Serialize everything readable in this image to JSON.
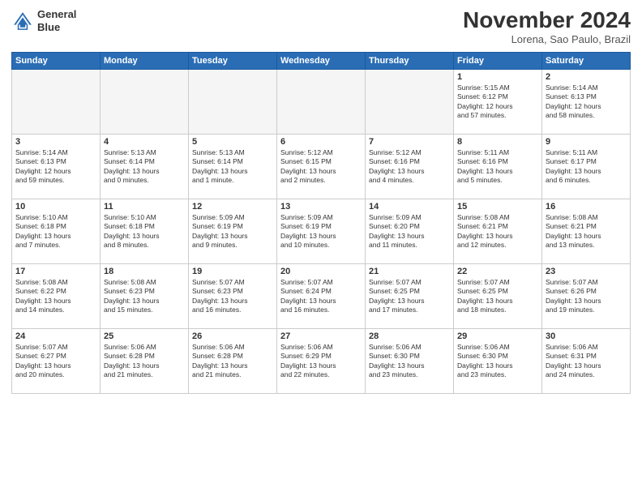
{
  "logo": {
    "line1": "General",
    "line2": "Blue"
  },
  "header": {
    "month": "November 2024",
    "location": "Lorena, Sao Paulo, Brazil"
  },
  "weekdays": [
    "Sunday",
    "Monday",
    "Tuesday",
    "Wednesday",
    "Thursday",
    "Friday",
    "Saturday"
  ],
  "weeks": [
    [
      {
        "day": "",
        "info": ""
      },
      {
        "day": "",
        "info": ""
      },
      {
        "day": "",
        "info": ""
      },
      {
        "day": "",
        "info": ""
      },
      {
        "day": "",
        "info": ""
      },
      {
        "day": "1",
        "info": "Sunrise: 5:15 AM\nSunset: 6:12 PM\nDaylight: 12 hours\nand 57 minutes."
      },
      {
        "day": "2",
        "info": "Sunrise: 5:14 AM\nSunset: 6:13 PM\nDaylight: 12 hours\nand 58 minutes."
      }
    ],
    [
      {
        "day": "3",
        "info": "Sunrise: 5:14 AM\nSunset: 6:13 PM\nDaylight: 12 hours\nand 59 minutes."
      },
      {
        "day": "4",
        "info": "Sunrise: 5:13 AM\nSunset: 6:14 PM\nDaylight: 13 hours\nand 0 minutes."
      },
      {
        "day": "5",
        "info": "Sunrise: 5:13 AM\nSunset: 6:14 PM\nDaylight: 13 hours\nand 1 minute."
      },
      {
        "day": "6",
        "info": "Sunrise: 5:12 AM\nSunset: 6:15 PM\nDaylight: 13 hours\nand 2 minutes."
      },
      {
        "day": "7",
        "info": "Sunrise: 5:12 AM\nSunset: 6:16 PM\nDaylight: 13 hours\nand 4 minutes."
      },
      {
        "day": "8",
        "info": "Sunrise: 5:11 AM\nSunset: 6:16 PM\nDaylight: 13 hours\nand 5 minutes."
      },
      {
        "day": "9",
        "info": "Sunrise: 5:11 AM\nSunset: 6:17 PM\nDaylight: 13 hours\nand 6 minutes."
      }
    ],
    [
      {
        "day": "10",
        "info": "Sunrise: 5:10 AM\nSunset: 6:18 PM\nDaylight: 13 hours\nand 7 minutes."
      },
      {
        "day": "11",
        "info": "Sunrise: 5:10 AM\nSunset: 6:18 PM\nDaylight: 13 hours\nand 8 minutes."
      },
      {
        "day": "12",
        "info": "Sunrise: 5:09 AM\nSunset: 6:19 PM\nDaylight: 13 hours\nand 9 minutes."
      },
      {
        "day": "13",
        "info": "Sunrise: 5:09 AM\nSunset: 6:19 PM\nDaylight: 13 hours\nand 10 minutes."
      },
      {
        "day": "14",
        "info": "Sunrise: 5:09 AM\nSunset: 6:20 PM\nDaylight: 13 hours\nand 11 minutes."
      },
      {
        "day": "15",
        "info": "Sunrise: 5:08 AM\nSunset: 6:21 PM\nDaylight: 13 hours\nand 12 minutes."
      },
      {
        "day": "16",
        "info": "Sunrise: 5:08 AM\nSunset: 6:21 PM\nDaylight: 13 hours\nand 13 minutes."
      }
    ],
    [
      {
        "day": "17",
        "info": "Sunrise: 5:08 AM\nSunset: 6:22 PM\nDaylight: 13 hours\nand 14 minutes."
      },
      {
        "day": "18",
        "info": "Sunrise: 5:08 AM\nSunset: 6:23 PM\nDaylight: 13 hours\nand 15 minutes."
      },
      {
        "day": "19",
        "info": "Sunrise: 5:07 AM\nSunset: 6:23 PM\nDaylight: 13 hours\nand 16 minutes."
      },
      {
        "day": "20",
        "info": "Sunrise: 5:07 AM\nSunset: 6:24 PM\nDaylight: 13 hours\nand 16 minutes."
      },
      {
        "day": "21",
        "info": "Sunrise: 5:07 AM\nSunset: 6:25 PM\nDaylight: 13 hours\nand 17 minutes."
      },
      {
        "day": "22",
        "info": "Sunrise: 5:07 AM\nSunset: 6:25 PM\nDaylight: 13 hours\nand 18 minutes."
      },
      {
        "day": "23",
        "info": "Sunrise: 5:07 AM\nSunset: 6:26 PM\nDaylight: 13 hours\nand 19 minutes."
      }
    ],
    [
      {
        "day": "24",
        "info": "Sunrise: 5:07 AM\nSunset: 6:27 PM\nDaylight: 13 hours\nand 20 minutes."
      },
      {
        "day": "25",
        "info": "Sunrise: 5:06 AM\nSunset: 6:28 PM\nDaylight: 13 hours\nand 21 minutes."
      },
      {
        "day": "26",
        "info": "Sunrise: 5:06 AM\nSunset: 6:28 PM\nDaylight: 13 hours\nand 21 minutes."
      },
      {
        "day": "27",
        "info": "Sunrise: 5:06 AM\nSunset: 6:29 PM\nDaylight: 13 hours\nand 22 minutes."
      },
      {
        "day": "28",
        "info": "Sunrise: 5:06 AM\nSunset: 6:30 PM\nDaylight: 13 hours\nand 23 minutes."
      },
      {
        "day": "29",
        "info": "Sunrise: 5:06 AM\nSunset: 6:30 PM\nDaylight: 13 hours\nand 23 minutes."
      },
      {
        "day": "30",
        "info": "Sunrise: 5:06 AM\nSunset: 6:31 PM\nDaylight: 13 hours\nand 24 minutes."
      }
    ]
  ]
}
